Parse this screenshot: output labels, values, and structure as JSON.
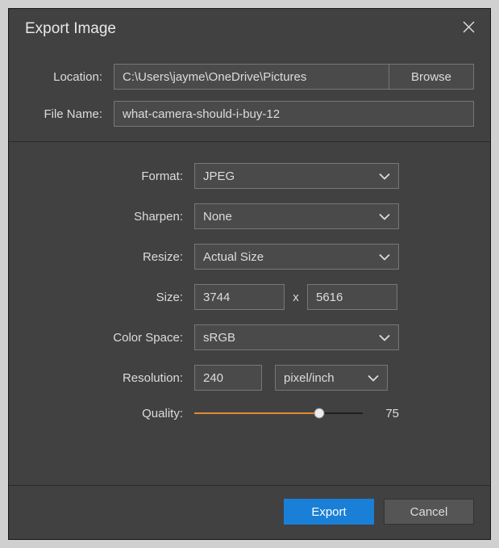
{
  "title": "Export Image",
  "top": {
    "location_label": "Location:",
    "location_value": "C:\\Users\\jayme\\OneDrive\\Pictures",
    "browse_label": "Browse",
    "filename_label": "File Name:",
    "filename_value": "what-camera-should-i-buy-12"
  },
  "form": {
    "format_label": "Format:",
    "format_value": "JPEG",
    "sharpen_label": "Sharpen:",
    "sharpen_value": "None",
    "resize_label": "Resize:",
    "resize_value": "Actual Size",
    "size_label": "Size:",
    "size_w": "3744",
    "size_sep": "x",
    "size_h": "5616",
    "colorspace_label": "Color Space:",
    "colorspace_value": "sRGB",
    "resolution_label": "Resolution:",
    "resolution_value": "240",
    "resolution_unit": "pixel/inch",
    "quality_label": "Quality:",
    "quality_value": "75"
  },
  "footer": {
    "export_label": "Export",
    "cancel_label": "Cancel"
  }
}
